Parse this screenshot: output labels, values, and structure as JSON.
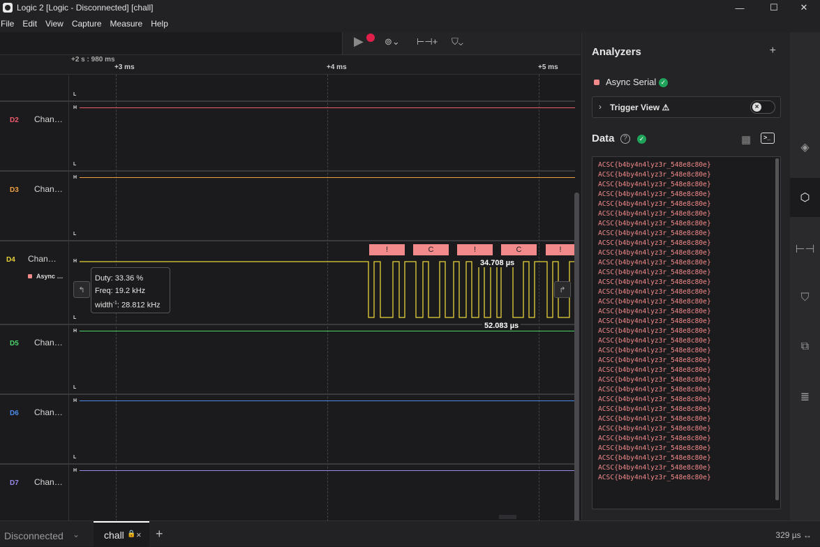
{
  "window": {
    "title": "Logic 2 [Logic - Disconnected] [chall]",
    "minimize": "—",
    "maximize": "☐",
    "close": "✕"
  },
  "menu": [
    "File",
    "Edit",
    "View",
    "Capture",
    "Measure",
    "Help"
  ],
  "timebar": {
    "origin": "+2 s : 980 ms",
    "ticks": [
      "+3 ms",
      "+4 ms",
      "+5 ms"
    ]
  },
  "channels": [
    {
      "id": "",
      "name": "",
      "color": "#e8e8e8"
    },
    {
      "id": "D2",
      "name": "Chan…",
      "color": "#f05a6a"
    },
    {
      "id": "D3",
      "name": "Chan…",
      "color": "#f0a040"
    },
    {
      "id": "D4",
      "name": "Chan…",
      "color": "#e8d23a",
      "analyzer": "Async …"
    },
    {
      "id": "D5",
      "name": "Chan…",
      "color": "#4ad46a"
    },
    {
      "id": "D6",
      "name": "Chan…",
      "color": "#4a8ae8"
    },
    {
      "id": "D7",
      "name": "Chan…",
      "color": "#9a8ae8"
    }
  ],
  "hl": {
    "high": "H",
    "low": "L"
  },
  "tooltip": {
    "duty": "Duty: 33.36 %",
    "freq": "Freq: 19.2 kHz",
    "width_prefix": "width",
    "width_sup": "-1",
    "width_value": ": 28.812 kHz"
  },
  "frames": [
    "!",
    "C",
    "!",
    "C",
    "!"
  ],
  "measurements": {
    "pulse": "34.708 µs",
    "period": "52.083 µs"
  },
  "analyzers": {
    "title": "Analyzers",
    "add": "+",
    "item": "Async Serial",
    "trigger_view": "Trigger View ⚠"
  },
  "data_panel": {
    "title": "Data",
    "help": "?",
    "terminal": ">_",
    "line": "ACSC{b4by4n4lyz3r_548e8c80e}",
    "line_count": 33
  },
  "status": {
    "connection": "Disconnected",
    "tab": "chall",
    "tab_close": "×",
    "new_tab": "+",
    "zoom": "329 µs ↔"
  }
}
